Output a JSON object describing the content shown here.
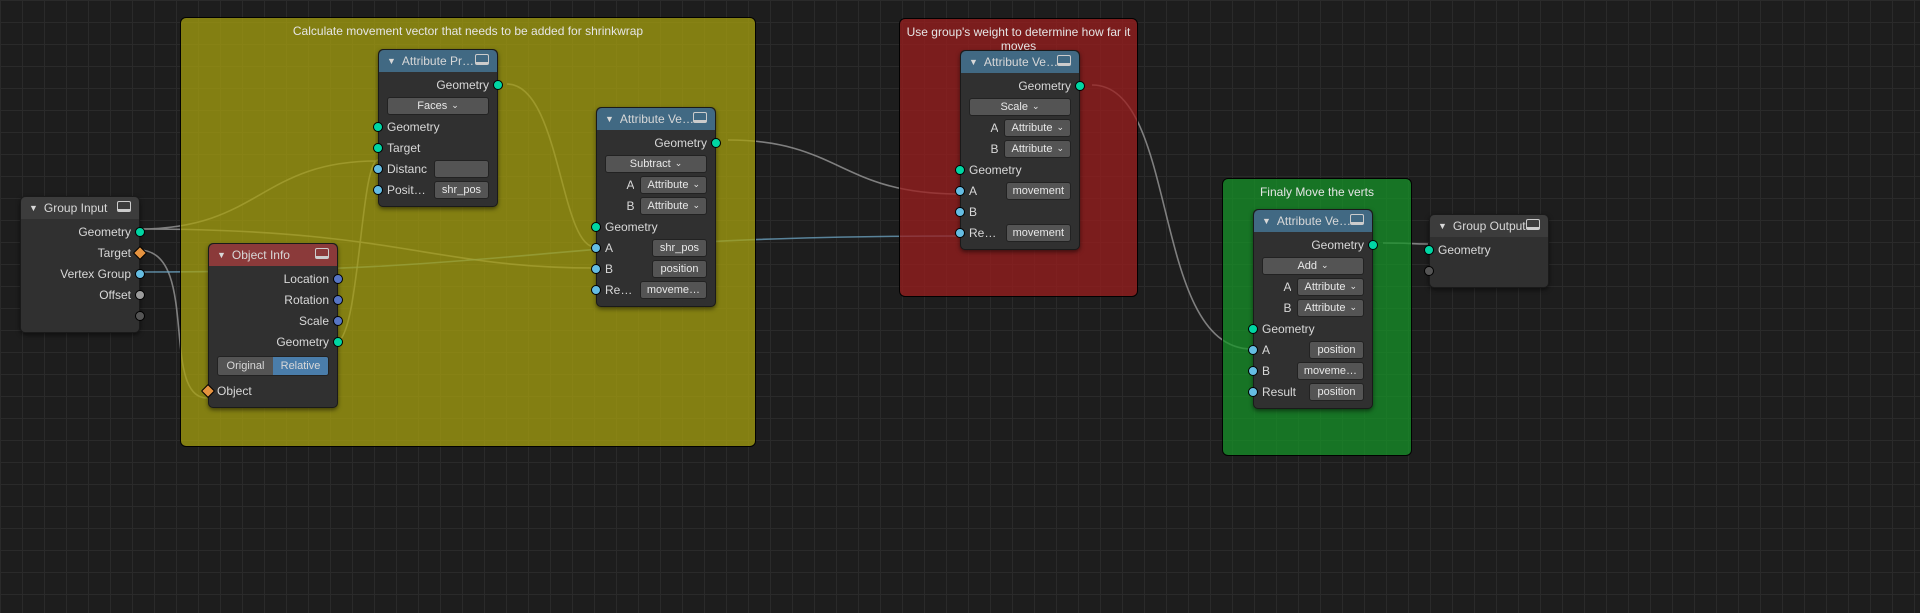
{
  "frames": {
    "calc": {
      "label": "Calculate movement vector that needs to be added for shrinkwrap"
    },
    "weight": {
      "label": "Use group's weight to determine how far it moves"
    },
    "move": {
      "label": "Finaly Move the verts"
    }
  },
  "nodes": {
    "group_input": {
      "title": "Group Input",
      "out": [
        "Geometry",
        "Target",
        "Vertex Group",
        "Offset"
      ]
    },
    "object_info": {
      "title": "Object Info",
      "out": [
        "Location",
        "Rotation",
        "Scale",
        "Geometry"
      ],
      "btn_original": "Original",
      "btn_relative": "Relative",
      "in_object": "Object"
    },
    "attr_prox": {
      "title": "Attribute Proximity",
      "out_geom": "Geometry",
      "dropdown": "Faces",
      "in_geom": "Geometry",
      "in_target": "Target",
      "in_dist": "Distanc",
      "in_dist_val": "",
      "in_pos": "Position",
      "in_pos_val": "shr_pos"
    },
    "avm1": {
      "title": "Attribute Vector M…",
      "out_geom": "Geometry",
      "op": "Subtract",
      "a_lbl": "A",
      "a_mode": "Attribute",
      "b_lbl": "B",
      "b_mode": "Attribute",
      "in_geom": "Geometry",
      "in_a": "A",
      "in_a_val": "shr_pos",
      "in_b": "B",
      "in_b_val": "position",
      "in_res": "Result",
      "in_res_val": "moveme…"
    },
    "avm2": {
      "title": "Attribute Vector M…",
      "out_geom": "Geometry",
      "op": "Scale",
      "a_lbl": "A",
      "a_mode": "Attribute",
      "b_lbl": "B",
      "b_mode": "Attribute",
      "in_geom": "Geometry",
      "in_a": "A",
      "in_a_val": "movement",
      "in_b": "B",
      "in_res": "Result",
      "in_res_val": "movement"
    },
    "avm3": {
      "title": "Attribute Vector M…",
      "out_geom": "Geometry",
      "op": "Add",
      "a_lbl": "A",
      "a_mode": "Attribute",
      "b_lbl": "B",
      "b_mode": "Attribute",
      "in_geom": "Geometry",
      "in_a": "A",
      "in_a_val": "position",
      "in_b": "B",
      "in_b_val": "moveme…",
      "in_res": "Result",
      "in_res_val": "position"
    },
    "group_output": {
      "title": "Group Output",
      "in_geom": "Geometry"
    }
  }
}
